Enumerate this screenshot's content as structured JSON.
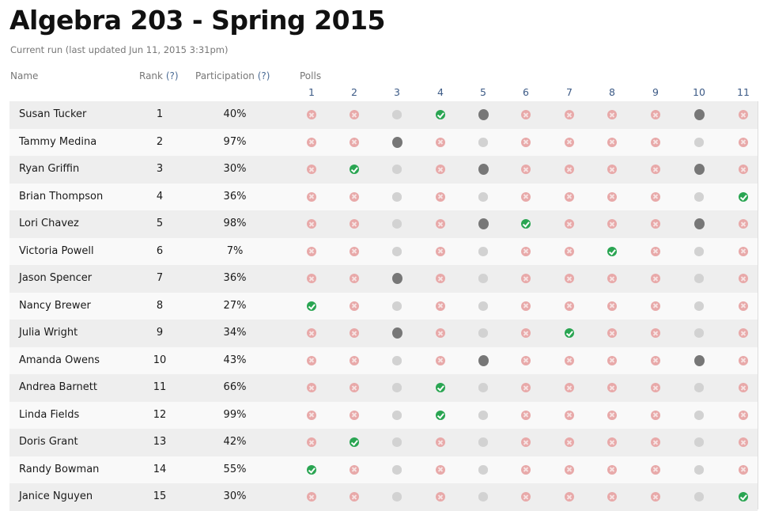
{
  "header": {
    "title": "Algebra 203 - Spring 2015",
    "subtitle": "Current run (last updated Jun 11, 2015 3:31pm)"
  },
  "columns": {
    "name": "Name",
    "rank": "Rank",
    "participation": "Participation",
    "help": "(?)",
    "polls": "Polls",
    "poll_numbers": [
      "1",
      "2",
      "3",
      "4",
      "5",
      "6",
      "7",
      "8",
      "9",
      "10",
      "11"
    ]
  },
  "legend_states": {
    "x": "incorrect",
    "c": "correct",
    "g": "no response",
    "d": "answered"
  },
  "colors": {
    "incorrect": "#e8a9a9",
    "correct": "#2aa552",
    "no_response": "#d2d2d2",
    "answered": "#777777",
    "link": "#3c5a86"
  },
  "rows": [
    {
      "name": "Susan Tucker",
      "rank": "1",
      "participation": "40%",
      "polls": [
        "x",
        "x",
        "g",
        "c",
        "d",
        "x",
        "x",
        "x",
        "x",
        "d",
        "x"
      ]
    },
    {
      "name": "Tammy Medina",
      "rank": "2",
      "participation": "97%",
      "polls": [
        "x",
        "x",
        "d",
        "x",
        "g",
        "x",
        "x",
        "x",
        "x",
        "g",
        "x"
      ]
    },
    {
      "name": "Ryan Griffin",
      "rank": "3",
      "participation": "30%",
      "polls": [
        "x",
        "c",
        "g",
        "x",
        "d",
        "x",
        "x",
        "x",
        "x",
        "d",
        "x"
      ]
    },
    {
      "name": "Brian Thompson",
      "rank": "4",
      "participation": "36%",
      "polls": [
        "x",
        "x",
        "g",
        "x",
        "g",
        "x",
        "x",
        "x",
        "x",
        "g",
        "c"
      ]
    },
    {
      "name": "Lori Chavez",
      "rank": "5",
      "participation": "98%",
      "polls": [
        "x",
        "x",
        "g",
        "x",
        "d",
        "c",
        "x",
        "x",
        "x",
        "d",
        "x"
      ]
    },
    {
      "name": "Victoria Powell",
      "rank": "6",
      "participation": "7%",
      "polls": [
        "x",
        "x",
        "g",
        "x",
        "g",
        "x",
        "x",
        "c",
        "x",
        "g",
        "x"
      ]
    },
    {
      "name": "Jason Spencer",
      "rank": "7",
      "participation": "36%",
      "polls": [
        "x",
        "x",
        "d",
        "x",
        "g",
        "x",
        "x",
        "x",
        "x",
        "g",
        "x"
      ]
    },
    {
      "name": "Nancy Brewer",
      "rank": "8",
      "participation": "27%",
      "polls": [
        "c",
        "x",
        "g",
        "x",
        "g",
        "x",
        "x",
        "x",
        "x",
        "g",
        "x"
      ]
    },
    {
      "name": "Julia Wright",
      "rank": "9",
      "participation": "34%",
      "polls": [
        "x",
        "x",
        "d",
        "x",
        "g",
        "x",
        "c",
        "x",
        "x",
        "g",
        "x"
      ]
    },
    {
      "name": "Amanda Owens",
      "rank": "10",
      "participation": "43%",
      "polls": [
        "x",
        "x",
        "g",
        "x",
        "d",
        "x",
        "x",
        "x",
        "x",
        "d",
        "x"
      ]
    },
    {
      "name": "Andrea Barnett",
      "rank": "11",
      "participation": "66%",
      "polls": [
        "x",
        "x",
        "g",
        "c",
        "g",
        "x",
        "x",
        "x",
        "x",
        "g",
        "x"
      ]
    },
    {
      "name": "Linda Fields",
      "rank": "12",
      "participation": "99%",
      "polls": [
        "x",
        "x",
        "g",
        "c",
        "g",
        "x",
        "x",
        "x",
        "x",
        "g",
        "x"
      ]
    },
    {
      "name": "Doris Grant",
      "rank": "13",
      "participation": "42%",
      "polls": [
        "x",
        "c",
        "g",
        "x",
        "g",
        "x",
        "x",
        "x",
        "x",
        "g",
        "x"
      ]
    },
    {
      "name": "Randy Bowman",
      "rank": "14",
      "participation": "55%",
      "polls": [
        "c",
        "x",
        "g",
        "x",
        "g",
        "x",
        "x",
        "x",
        "x",
        "g",
        "x"
      ]
    },
    {
      "name": "Janice Nguyen",
      "rank": "15",
      "participation": "30%",
      "polls": [
        "x",
        "x",
        "g",
        "x",
        "g",
        "x",
        "x",
        "x",
        "x",
        "g",
        "c"
      ]
    }
  ]
}
